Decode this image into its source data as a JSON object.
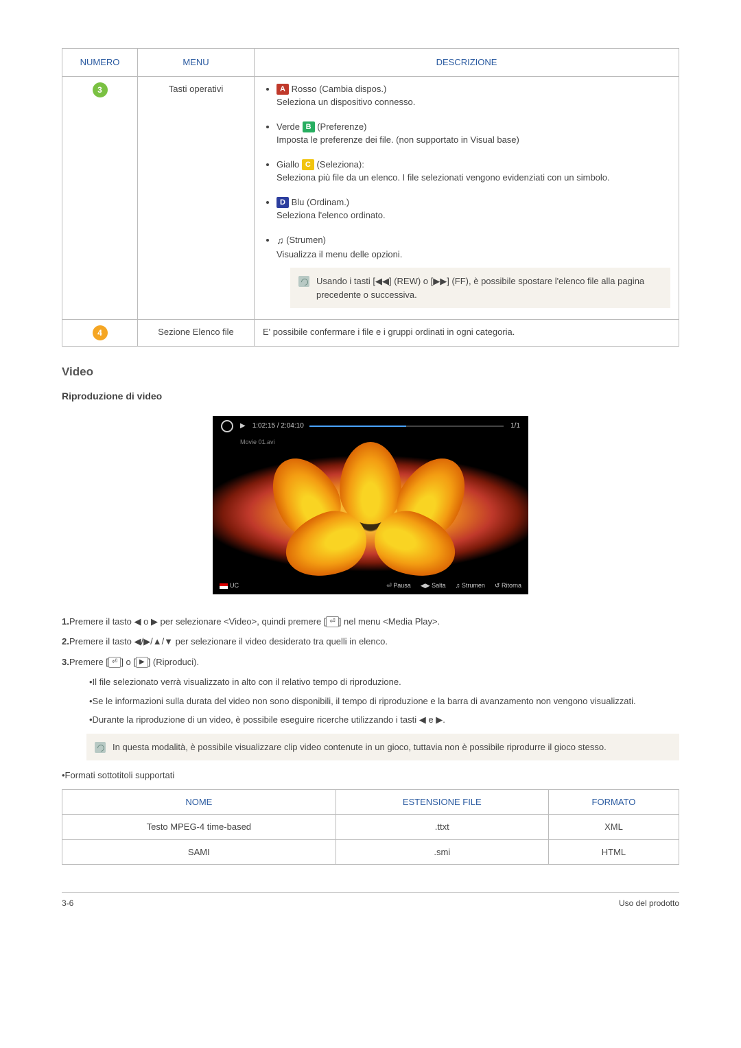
{
  "table1": {
    "headers": {
      "numero": "NUMERO",
      "menu": "MENU",
      "descrizione": "DESCRIZIONE"
    },
    "row3": {
      "badge": "3",
      "menu": "Tasti operativi",
      "items": [
        {
          "letter": "A",
          "letter_class": "lb-red",
          "prefix": "",
          "label": " Rosso (Cambia dispos.)",
          "desc": "Seleziona un dispositivo connesso."
        },
        {
          "letter": "B",
          "letter_class": "lb-green",
          "prefix": "Verde ",
          "label": " (Preferenze)",
          "desc": "Imposta le preferenze dei file. (non supportato in Visual base)"
        },
        {
          "letter": "C",
          "letter_class": "lb-yellow",
          "prefix": "Giallo ",
          "label": " (Seleziona):",
          "desc": "Seleziona più file da un elenco. I file selezionati vengono evidenziati con un simbolo."
        },
        {
          "letter": "D",
          "letter_class": "lb-blue",
          "prefix": "",
          "label": " Blu (Ordinam.)",
          "desc": "Seleziona l'elenco ordinato."
        },
        {
          "tool": "♫",
          "prefix": "",
          "label": " (Strumen)",
          "desc": "Visualizza il menu delle opzioni."
        }
      ],
      "note": "Usando i tasti [◀◀] (REW) o [▶▶] (FF), è possibile spostare l'elenco file alla pagina precedente o successiva."
    },
    "row4": {
      "badge": "4",
      "menu": "Sezione Elenco file",
      "desc": "E' possibile confermare i file e i gruppi ordinati in ogni categoria."
    }
  },
  "video_section": "Video",
  "video_subtitle": "Riproduzione di video",
  "player": {
    "time": "1:02:15 / 2:04:10",
    "counter": "1/1",
    "filename": "Movie 01.avi",
    "uc_label": "UC",
    "controls": {
      "pausa": "⏎ Pausa",
      "salta": "◀▶ Salta",
      "strumen": "♫ Strumen",
      "ritorna": "↺ Ritorna"
    }
  },
  "steps": {
    "s1a": "1.",
    "s1b": "Premere il tasto ◀ o ▶ per selezionare <Video>, quindi premere [",
    "s1c": "] nel menu <Media Play>.",
    "s2a": "2.",
    "s2b": "Premere il tasto ◀/▶/▲/▼ per selezionare il video desiderato tra quelli in elenco.",
    "s3a": "3.",
    "s3b": "Premere [",
    "s3c": "] o [",
    "s3d": "] (Riproduci).",
    "b1": "•Il file selezionato verrà visualizzato in alto con il relativo tempo di riproduzione.",
    "b2": "•Se le informazioni sulla durata del video non sono disponibili, il tempo di riproduzione e la barra di avanzamento non vengono visualizzati.",
    "b3": "•Durante la riproduzione di un video, è possibile eseguire ricerche utilizzando i tasti ◀ e ▶.",
    "note": "In questa modalità, è possibile visualizzare clip video contenute in un gioco, tuttavia non è possibile riprodurre il gioco stesso.",
    "formats_label": "•Formati sottotitoli supportati"
  },
  "enter_key": "⏎",
  "play_key": "▶",
  "subtitle_table": {
    "headers": {
      "nome": "NOME",
      "ext": "ESTENSIONE FILE",
      "formato": "FORMATO"
    },
    "rows": [
      {
        "nome": "Testo MPEG-4 time-based",
        "ext": ".ttxt",
        "formato": "XML"
      },
      {
        "nome": "SAMI",
        "ext": ".smi",
        "formato": "HTML"
      }
    ]
  },
  "footer": {
    "left": "3-6",
    "right": "Uso del prodotto"
  }
}
